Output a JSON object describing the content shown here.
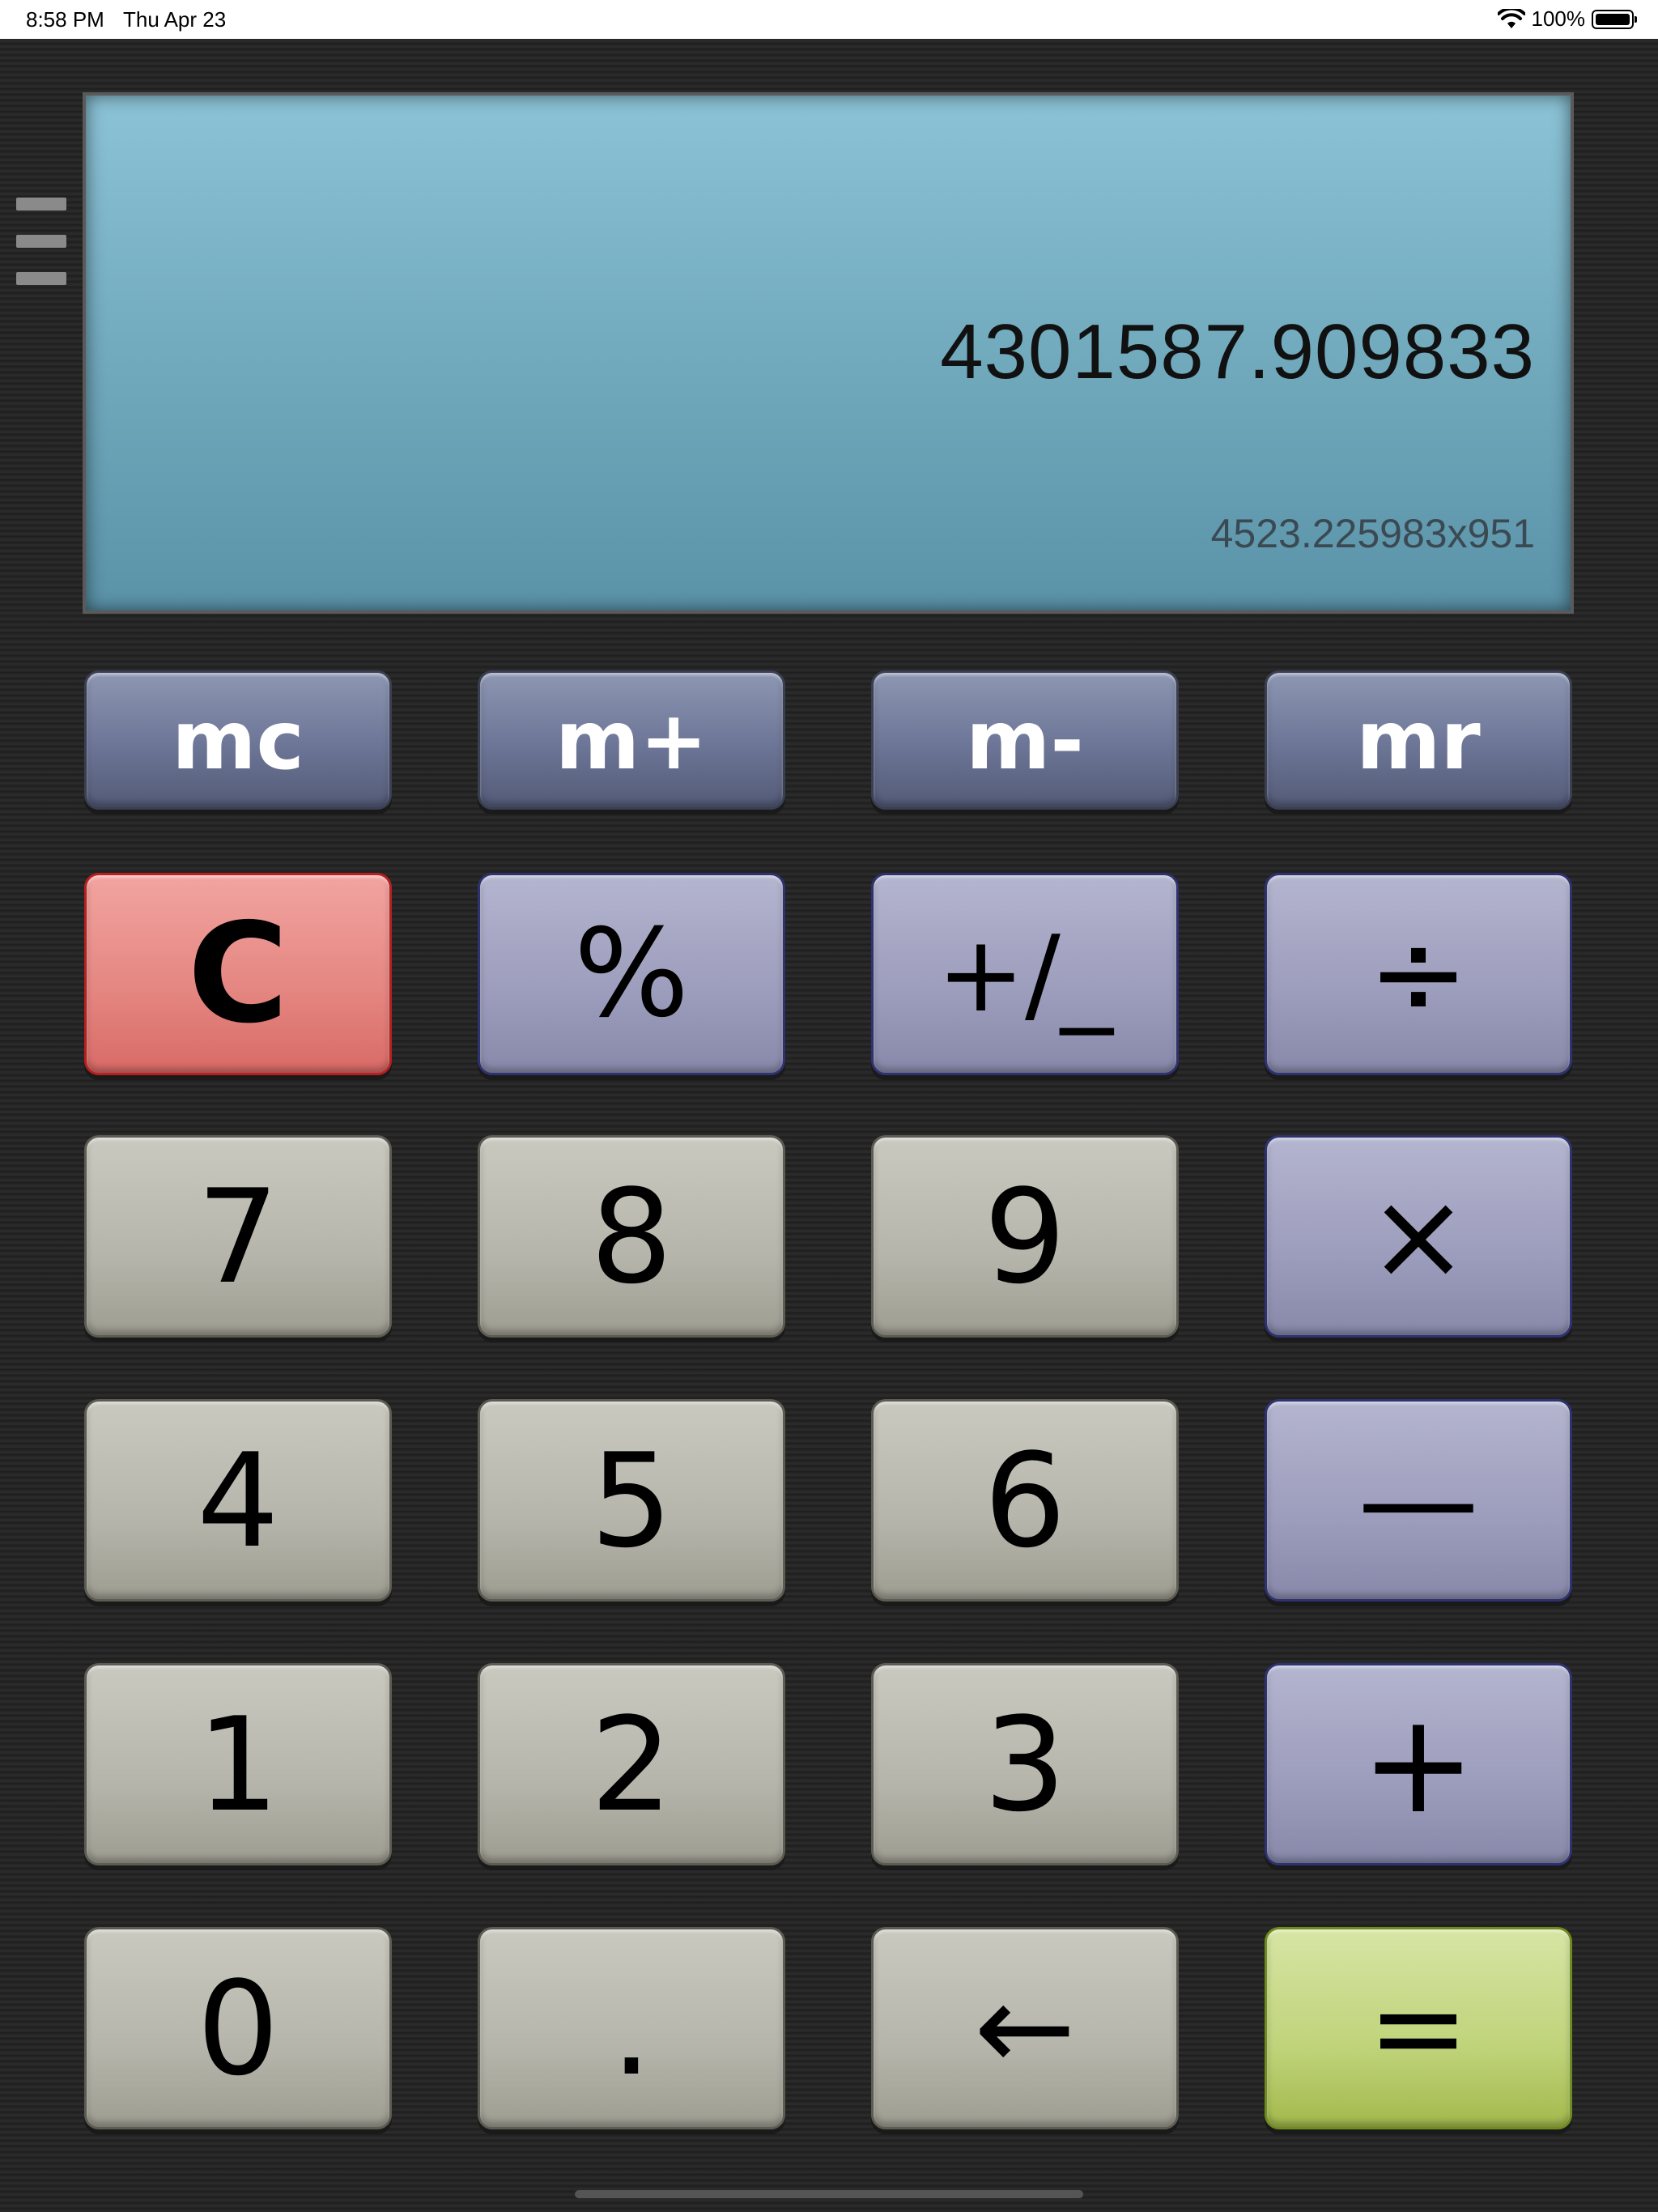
{
  "status_bar": {
    "time": "8:58 PM",
    "date": "Thu Apr 23",
    "battery": "100%"
  },
  "display": {
    "value": "4301587.909833",
    "expression": "4523.225983x951"
  },
  "memory_keys": [
    "mc",
    "m+",
    "m-",
    "mr"
  ],
  "keys": {
    "clear": "C",
    "percent": "%",
    "sign": "+/_",
    "divide": "÷",
    "seven": "7",
    "eight": "8",
    "nine": "9",
    "multiply": "×",
    "four": "4",
    "five": "5",
    "six": "6",
    "subtract": "—",
    "one": "1",
    "two": "2",
    "three": "3",
    "add": "+",
    "zero": "0",
    "decimal": ".",
    "backspace": "←",
    "equals": "="
  },
  "colors": {
    "display_bg": "#7fb6ca",
    "memory_key": "#6c7596",
    "operator_key": "#9c9cbc",
    "number_key": "#b5b5ab",
    "clear_key": "#e48580",
    "equals_key": "#bfd37a"
  }
}
